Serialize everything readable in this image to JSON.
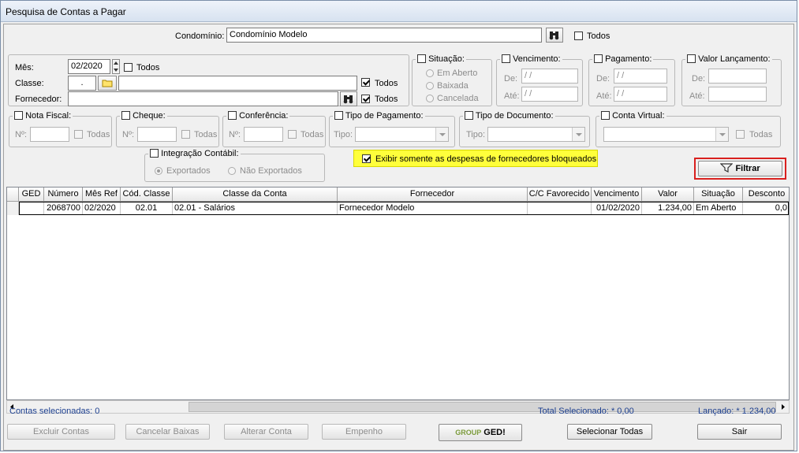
{
  "window": {
    "title": "Pesquisa de Contas a Pagar"
  },
  "condominio": {
    "label": "Condomínio:",
    "value": "Condomínio Modelo",
    "todos": "Todos"
  },
  "mes": {
    "label": "Mês:",
    "value": "02/2020",
    "todos": "Todos"
  },
  "classe": {
    "label": "Classe:",
    "code": ".",
    "name": "",
    "todos": "Todos"
  },
  "fornecedor": {
    "label": "Fornecedor:",
    "value": "",
    "todos": "Todos"
  },
  "situacao": {
    "title": "Situação:",
    "options": [
      "Em Aberto",
      "Baixada",
      "Cancelada"
    ]
  },
  "vencimento": {
    "title": "Vencimento:",
    "de_label": "De:",
    "ate_label": "Até:",
    "de": " / /",
    "ate": " / /"
  },
  "pagamento": {
    "title": "Pagamento:",
    "de_label": "De:",
    "ate_label": "Até:",
    "de": " / /",
    "ate": " / /"
  },
  "valor_lancamento": {
    "title": "Valor Lançamento:",
    "de_label": "De:",
    "ate_label": "Até:"
  },
  "nota_fiscal": {
    "title": "Nota Fiscal:",
    "num_label": "Nº:",
    "todas": "Todas"
  },
  "cheque": {
    "title": "Cheque:",
    "num_label": "Nº:",
    "todas": "Todas"
  },
  "conferencia": {
    "title": "Conferência:",
    "num_label": "Nº:",
    "todas": "Todas"
  },
  "tipo_pagamento": {
    "title": "Tipo de Pagamento:",
    "tipo_label": "Tipo:"
  },
  "tipo_documento": {
    "title": "Tipo de Documento:",
    "tipo_label": "Tipo:"
  },
  "conta_virtual": {
    "title": "Conta Virtual:",
    "todas": "Todas"
  },
  "integracao": {
    "title": "Integração Contábil:",
    "options": [
      "Exportados",
      "Não Exportados"
    ]
  },
  "bloqueados": {
    "label": "Exibir somente as despesas de fornecedores bloqueados"
  },
  "filtrar": {
    "label": "Filtrar"
  },
  "grid": {
    "columns": [
      "GED",
      "Número",
      "Mês Ref",
      "Cód. Classe",
      "Classe da Conta",
      "Fornecedor",
      "C/C Favorecido",
      "Vencimento",
      "Valor",
      "Situação",
      "Desconto"
    ],
    "rows": [
      {
        "ged": "",
        "numero": "2068700",
        "mes_ref": "02/2020",
        "cod_classe": "02.01",
        "classe_conta": "02.01 - Salários",
        "fornecedor": "Fornecedor Modelo",
        "cc_favorecido": "",
        "vencimento": "01/02/2020",
        "valor": "1.234,00",
        "situacao": "Em Aberto",
        "desconto": "0,0"
      }
    ]
  },
  "status": {
    "contas_selecionadas": "Contas selecionadas: 0",
    "total_selecionado": "Total Selecionado: * 0,00",
    "lancado": "Lançado: * 1.234,00"
  },
  "buttons": {
    "excluir": "Excluir Contas",
    "cancelar": "Cancelar Baixas",
    "alterar": "Alterar Conta",
    "empenho": "Empenho",
    "group_ged_a": "GROUP",
    "group_ged_b": "GED!",
    "selecionar": "Selecionar Todas",
    "sair": "Sair"
  },
  "colors": {
    "highlight_bg": "#ffff3b",
    "filter_border": "#d9201e",
    "status_text": "#1c3f8f"
  }
}
